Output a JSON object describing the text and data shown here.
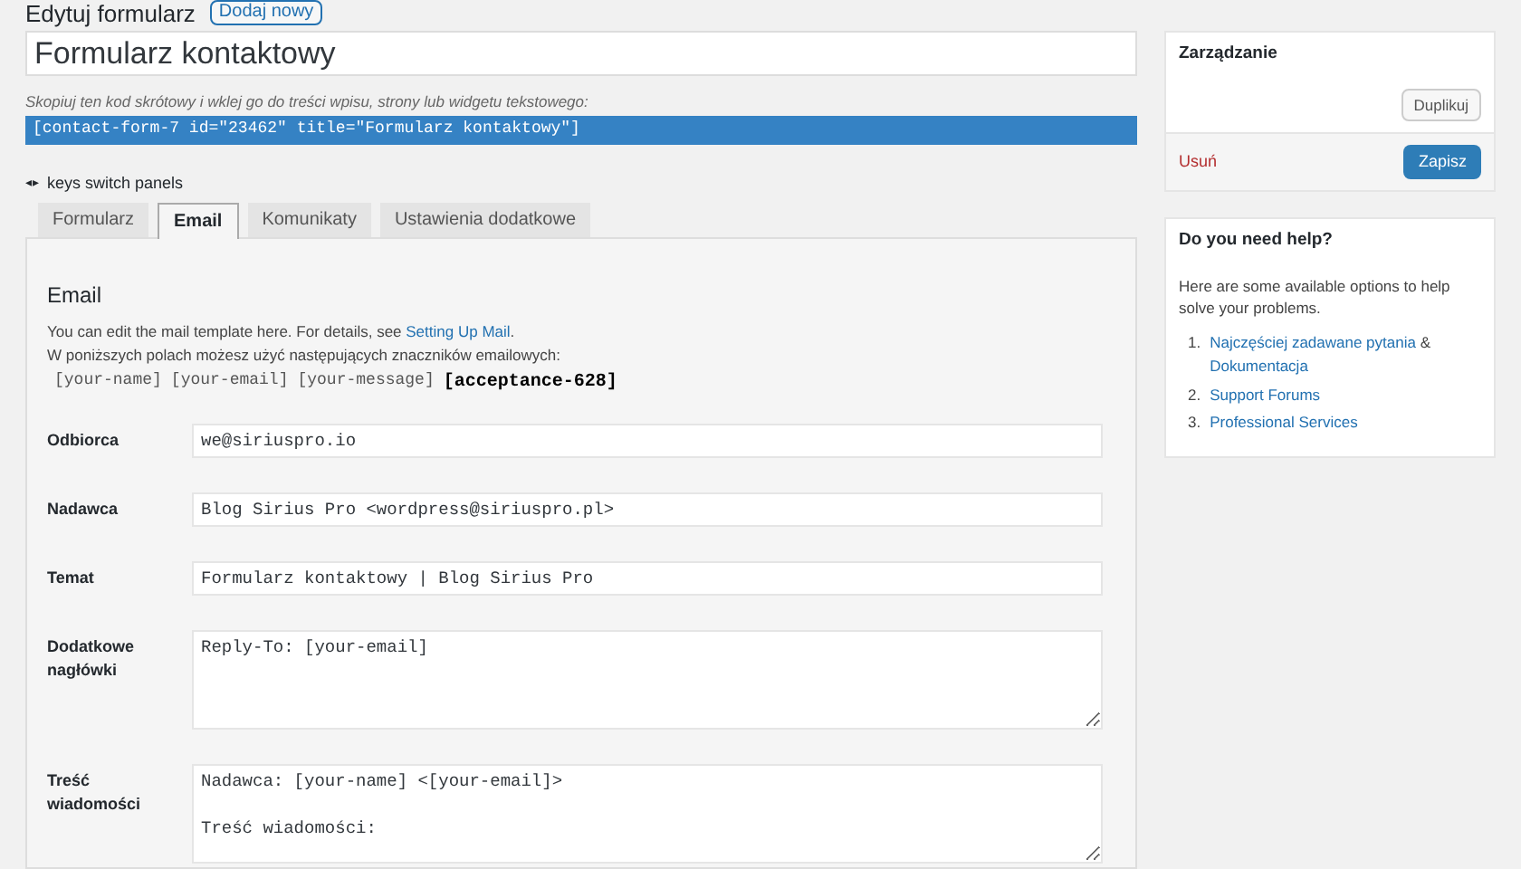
{
  "header": {
    "title": "Edytuj formularz",
    "add_button": "Dodaj nowy"
  },
  "form_title": {
    "value": "Formularz kontaktowy"
  },
  "shortcode": {
    "hint": "Skopiuj ten kod skrótowy i wklej go do treści wpisu, strony lub widgetu tekstowego:",
    "code": "[contact-form-7 id=\"23462\" title=\"Formularz kontaktowy\"]"
  },
  "keys_hint": {
    "icon": "◂▸",
    "text": "keys switch panels"
  },
  "tabs": [
    {
      "label": "Formularz",
      "selected": false
    },
    {
      "label": "Email",
      "selected": true
    },
    {
      "label": "Komunikaty",
      "selected": false
    },
    {
      "label": "Ustawienia dodatkowe",
      "selected": false
    }
  ],
  "panel": {
    "heading": "Email",
    "intro": "You can edit the mail template here. For details, see ",
    "intro_link": "Setting Up Mail",
    "intro_end": ".",
    "tags_note": "W poniższych polach możesz użyć następujących znaczników emailowych:",
    "tags": [
      {
        "text": "[your-name]",
        "bold": false
      },
      {
        "text": "[your-email]",
        "bold": false
      },
      {
        "text": "[your-message]",
        "bold": false
      },
      {
        "text": "[acceptance-628]",
        "bold": true
      }
    ],
    "fields": [
      {
        "label": "Odbiorca",
        "kind": "input",
        "value": "we@siriuspro.io"
      },
      {
        "label": "Nadawca",
        "kind": "input",
        "value": "Blog Sirius Pro <wordpress@siriuspro.pl>"
      },
      {
        "label": "Temat",
        "kind": "input",
        "value": "Formularz kontaktowy | Blog Sirius Pro"
      },
      {
        "label": "Dodatkowe nagłówki",
        "kind": "textarea",
        "lines": [
          "Reply-To: [your-email]"
        ]
      },
      {
        "label": "Treść wiadomości",
        "kind": "textarea",
        "paragraphs": [
          "Nadawca: [your-name] <[your-email]>",
          "Treść wiadomości:"
        ]
      }
    ]
  },
  "sidebar": {
    "manage": {
      "title": "Zarządzanie",
      "duplicate": "Duplikuj",
      "delete": "Usuń",
      "save": "Zapisz"
    },
    "help": {
      "title": "Do you need help?",
      "text": "Here are some available options to help solve your problems.",
      "links": [
        {
          "number": "1.",
          "parts": [
            "Najczęściej zadawane pytania",
            " & ",
            "Dokumentacja"
          ]
        },
        {
          "number": "2.",
          "parts": [
            "Support Forums"
          ]
        },
        {
          "number": "3.",
          "parts": [
            "Professional Services"
          ]
        }
      ]
    }
  }
}
